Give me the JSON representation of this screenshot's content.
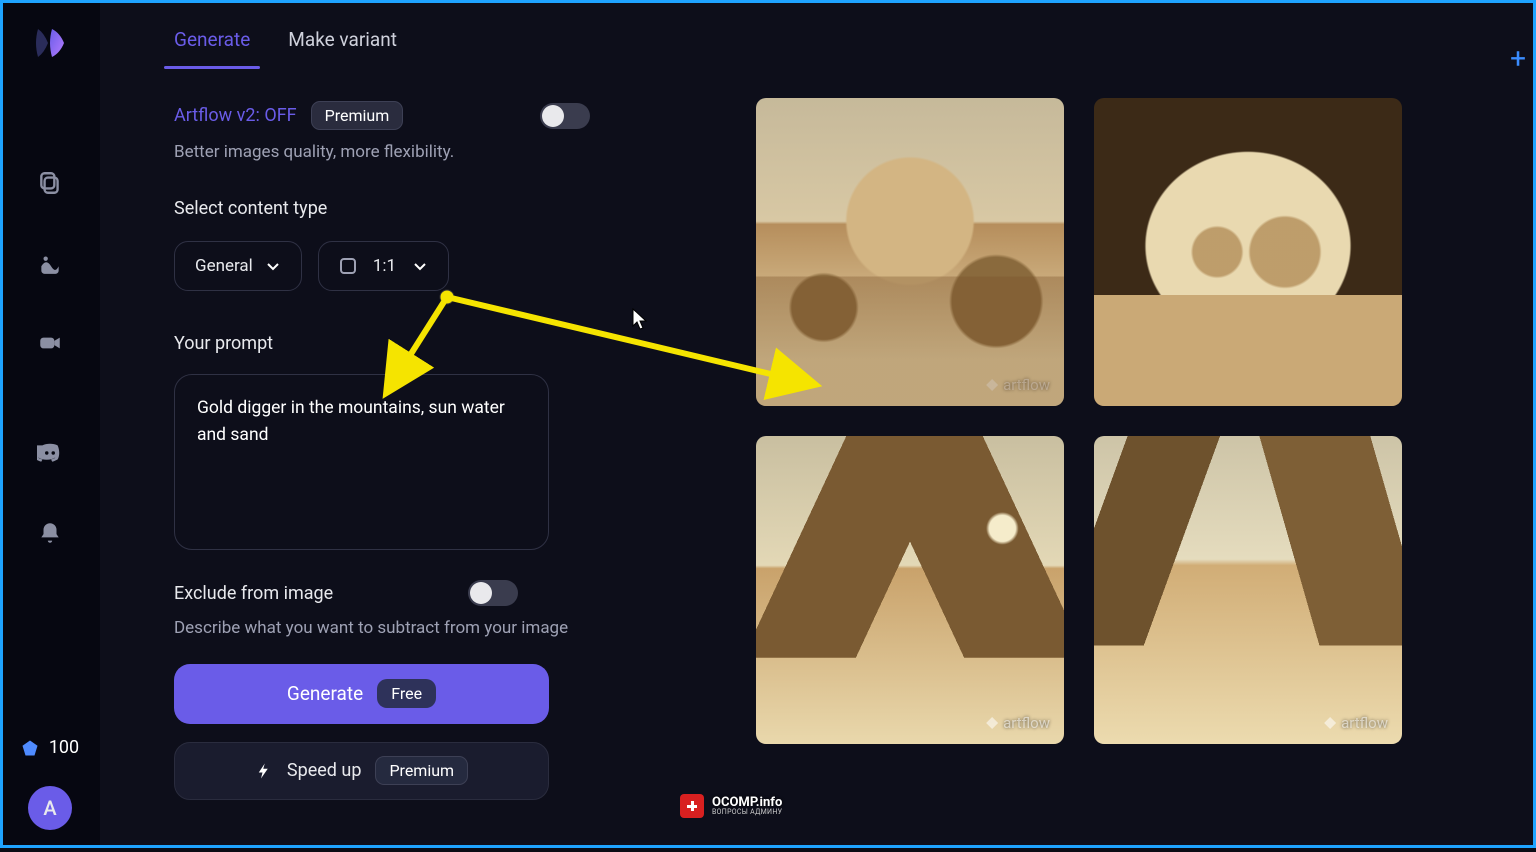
{
  "sidebar": {
    "credits": "100",
    "avatar_initial": "A"
  },
  "tabs": {
    "generate": "Generate",
    "variant": "Make variant"
  },
  "v2": {
    "label": "Artflow v2:",
    "state": "OFF",
    "badge": "Premium",
    "subtitle": "Better images quality, more flexibility."
  },
  "content_type": {
    "label": "Select content type",
    "general": "General",
    "ratio": "1:1"
  },
  "prompt": {
    "label": "Your prompt",
    "text": "Gold digger in the mountains, sun water and sand"
  },
  "exclude": {
    "label": "Exclude from image",
    "desc": "Describe what you want to subtract from your image"
  },
  "generate_btn": {
    "label": "Generate",
    "badge": "Free"
  },
  "speed_btn": {
    "label": "Speed up",
    "badge": "Premium"
  },
  "watermark": "artflow",
  "ocomp": {
    "line1": "OCOMP.info",
    "line2": "ВОПРОСЫ АДМИНУ"
  }
}
